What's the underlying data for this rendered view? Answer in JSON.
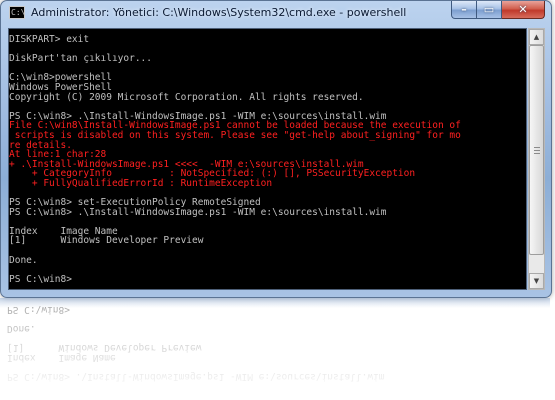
{
  "window": {
    "title": "Administrator: Yönetici: C:\\Windows\\System32\\cmd.exe - powershell",
    "controls": {
      "minimize": "–",
      "maximize": "▭",
      "close": "✕"
    },
    "app_icon_glyph": "C:\\"
  },
  "console": {
    "lines": [
      {
        "text": "DISKPART> exit",
        "color": "#c0c0c0"
      },
      {
        "text": "",
        "color": "#c0c0c0"
      },
      {
        "text": "DiskPart'tan çıkılıyor...",
        "color": "#c0c0c0"
      },
      {
        "text": "",
        "color": "#c0c0c0"
      },
      {
        "text": "C:\\win8>powershell",
        "color": "#c0c0c0"
      },
      {
        "text": "Windows PowerShell",
        "color": "#c0c0c0"
      },
      {
        "text": "Copyright (C) 2009 Microsoft Corporation. All rights reserved.",
        "color": "#c0c0c0"
      },
      {
        "text": "",
        "color": "#c0c0c0"
      },
      {
        "text": "PS C:\\win8> .\\Install-WindowsImage.ps1 -WIM e:\\sources\\install.wim",
        "color": "#c0c0c0"
      },
      {
        "text": "File C:\\win8\\Install-WindowsImage.ps1 cannot be loaded because the execution of",
        "color": "#ff2020"
      },
      {
        "text": " scripts is disabled on this system. Please see \"get-help about_signing\" for mo",
        "color": "#ff2020"
      },
      {
        "text": "re details.",
        "color": "#ff2020"
      },
      {
        "text": "At line:1 char:28",
        "color": "#ff2020"
      },
      {
        "text": "+ .\\Install-WindowsImage.ps1 <<<<  -WIM e:\\sources\\install.wim",
        "color": "#ff2020"
      },
      {
        "text": "    + CategoryInfo          : NotSpecified: (:) [], PSSecurityException",
        "color": "#ff2020"
      },
      {
        "text": "    + FullyQualifiedErrorId : RuntimeException",
        "color": "#ff2020"
      },
      {
        "text": "",
        "color": "#c0c0c0"
      },
      {
        "text": "PS C:\\win8> set-ExecutionPolicy RemoteSigned",
        "color": "#c0c0c0"
      },
      {
        "text": "PS C:\\win8> .\\Install-WindowsImage.ps1 -WIM e:\\sources\\install.wim",
        "color": "#c0c0c0"
      },
      {
        "text": "",
        "color": "#c0c0c0"
      },
      {
        "text": "Index    Image Name",
        "color": "#c0c0c0"
      },
      {
        "text": "[1]      Windows Developer Preview",
        "color": "#c0c0c0"
      },
      {
        "text": "",
        "color": "#c0c0c0"
      },
      {
        "text": "Done.",
        "color": "#c0c0c0"
      },
      {
        "text": "",
        "color": "#c0c0c0"
      },
      {
        "text": "PS C:\\win8>",
        "color": "#c0c0c0"
      }
    ]
  },
  "scrollbar": {
    "up_arrow": "▲",
    "down_arrow": "▼"
  },
  "colors": {
    "console_background": "#000000",
    "console_text": "#c0c0c0",
    "error_text": "#ff2020",
    "frame_accent": "#9fbbe0"
  }
}
